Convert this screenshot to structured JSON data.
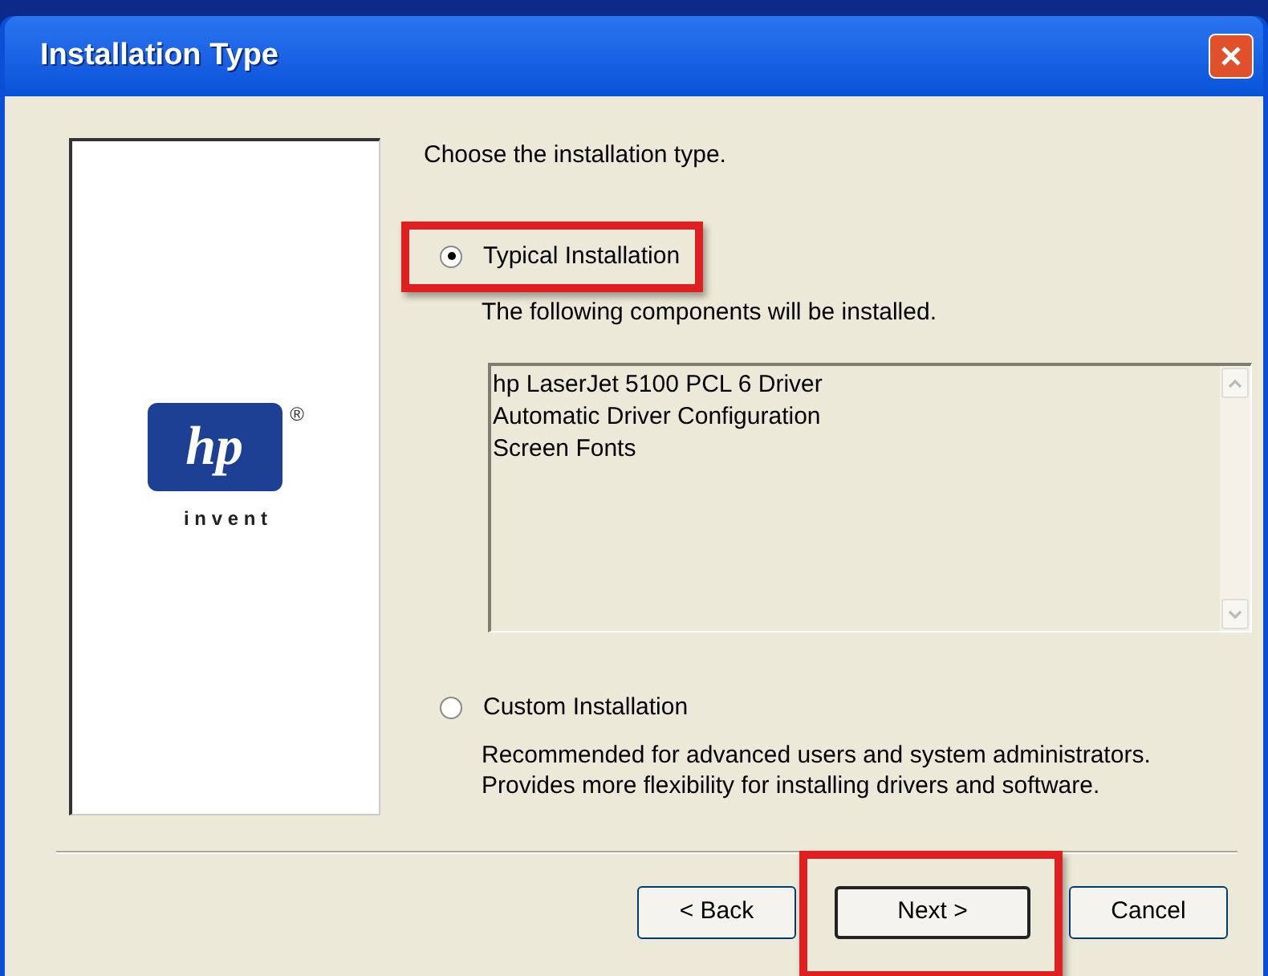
{
  "window": {
    "title": "Installation Type"
  },
  "logo": {
    "mark": "hp",
    "registered": "®",
    "tagline": "i n v e n t"
  },
  "prompt": "Choose the installation type.",
  "options": [
    {
      "label": "Typical Installation",
      "selected": true,
      "highlighted": true,
      "description": "The following components will be installed."
    },
    {
      "label": "Custom Installation",
      "selected": false,
      "highlighted": false,
      "description": "Recommended for advanced users and system administrators.  Provides more flexibility for installing drivers and software."
    }
  ],
  "components": [
    "hp LaserJet 5100 PCL 6 Driver",
    "Automatic Driver Configuration",
    "Screen Fonts"
  ],
  "buttons": [
    {
      "label": "< Back",
      "highlighted": false,
      "default": false
    },
    {
      "label": "Next >",
      "highlighted": true,
      "default": true
    },
    {
      "label": "Cancel",
      "highlighted": false,
      "default": false
    }
  ]
}
